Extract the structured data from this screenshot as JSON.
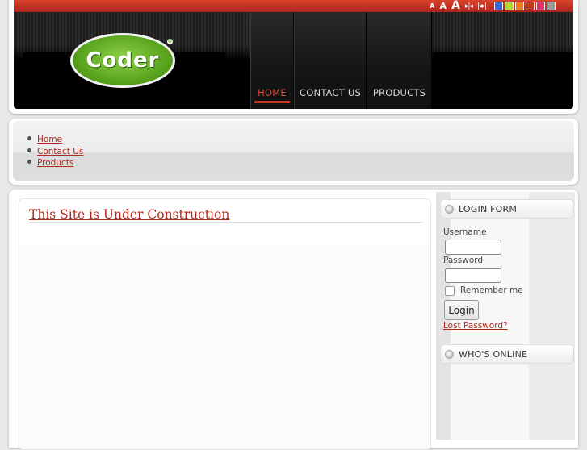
{
  "toolbar": {
    "font_small": "A",
    "font_medium": "A",
    "font_large": "A",
    "width_narrow_icon": "▸|◂",
    "width_wide_icon": "|◂▸|",
    "swatches": [
      "#3c67d8",
      "#b7d53a",
      "#f07a1c",
      "#b5401f",
      "#e0356f",
      "#9a9a9a"
    ]
  },
  "header": {
    "logo_text": "Coder",
    "logo_reg": "®"
  },
  "nav": {
    "home": "HOME",
    "contact": "CONTACT US",
    "products": "PRODUCTS",
    "active_color": "#e14a36"
  },
  "links": [
    "Home",
    "Contact Us",
    "Products"
  ],
  "content": {
    "title": "This Site is Under Construction"
  },
  "login": {
    "title": "LOGIN FORM",
    "username_label": "Username",
    "password_label": "Password",
    "remember_label": "Remember me",
    "button": "Login",
    "lost_password": "Lost Password?"
  },
  "online": {
    "title": "WHO'S ONLINE"
  },
  "colors": {
    "accent_red": "#b02a1a",
    "brand_green": "#5aa51e"
  }
}
